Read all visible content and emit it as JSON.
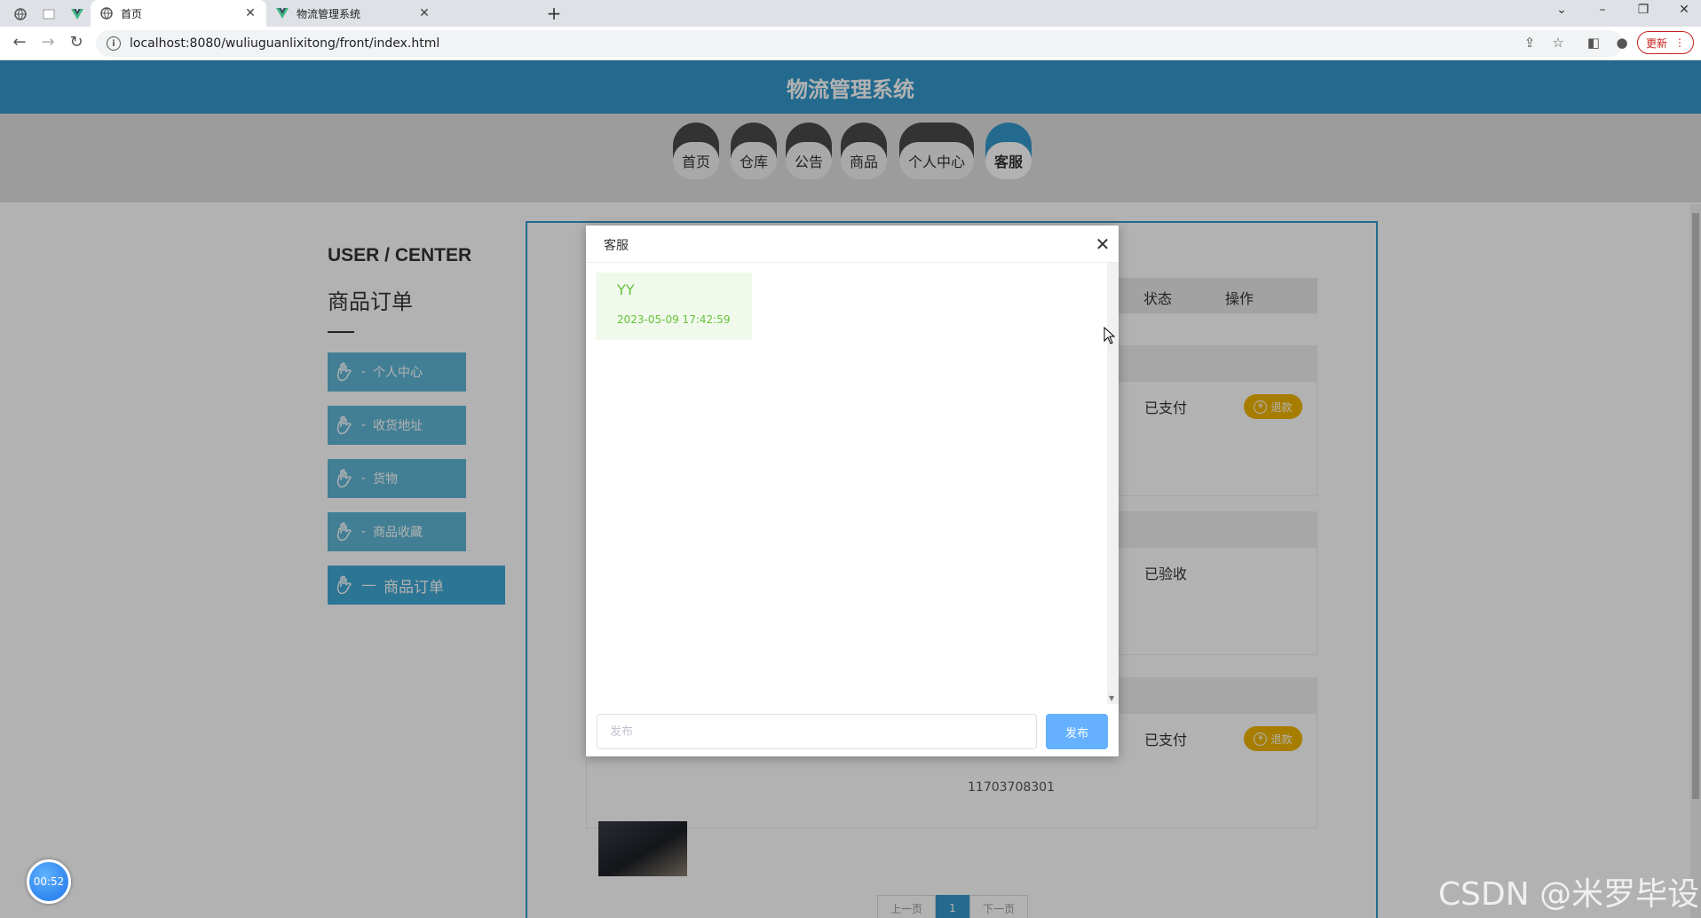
{
  "browser": {
    "tabs": [
      {
        "title": "首页",
        "icon": "globe-icon",
        "active": true
      },
      {
        "title": "物流管理系统",
        "icon": "vue-logo-icon",
        "active": false
      }
    ],
    "url": "localhost:8080/wuliuguanlixitong/front/index.html",
    "update_label": "更新"
  },
  "site": {
    "title": "物流管理系统",
    "nav": [
      "首页",
      "仓库",
      "公告",
      "商品",
      "个人中心",
      "客服"
    ],
    "nav_active": "客服"
  },
  "sidebar": {
    "heading": "USER / CENTER",
    "subheading": "商品订单",
    "items": [
      {
        "label": "个人中心",
        "icon": "hand-icon"
      },
      {
        "label": "收货地址",
        "icon": "hand-icon"
      },
      {
        "label": "货物",
        "icon": "hand-icon"
      },
      {
        "label": "商品收藏",
        "icon": "hand-icon"
      },
      {
        "label": "商品订单",
        "icon": "hand-icon",
        "active": true
      }
    ]
  },
  "orders": {
    "columns": [
      "状态",
      "操作"
    ],
    "rows": [
      {
        "status": "已支付",
        "action": "退款"
      },
      {
        "status": "已验收",
        "action": ""
      },
      {
        "status": "已支付",
        "action": "退款"
      }
    ],
    "partial_number": "11703708301",
    "pagination": {
      "prev": "上一页",
      "current": "1",
      "next": "下一页"
    }
  },
  "dialog": {
    "title": "客服",
    "messages": [
      {
        "sender": "YY",
        "time": "2023-05-09 17:42:59"
      }
    ],
    "input_placeholder": "发布",
    "send_label": "发布"
  },
  "overlay": {
    "timer": "00:52",
    "watermark": "CSDN @米罗毕设"
  },
  "colors": {
    "primary": "#3399cc",
    "refund": "#f0b400",
    "chat_green": "#67c23a",
    "send_button": "#66b1ff"
  }
}
